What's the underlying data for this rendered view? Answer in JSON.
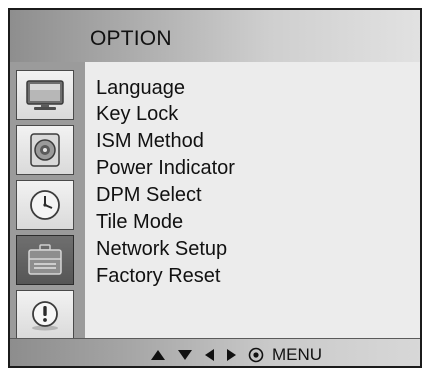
{
  "title": "OPTION",
  "sidebar": {
    "icons": [
      {
        "name": "monitor-icon"
      },
      {
        "name": "audio-icon"
      },
      {
        "name": "clock-icon"
      },
      {
        "name": "option-icon",
        "selected": true
      },
      {
        "name": "warning-icon"
      }
    ]
  },
  "menu": {
    "items": [
      {
        "label": "Language"
      },
      {
        "label": "Key Lock"
      },
      {
        "label": "ISM Method"
      },
      {
        "label": "Power Indicator"
      },
      {
        "label": "DPM Select"
      },
      {
        "label": "Tile Mode"
      },
      {
        "label": "Network Setup"
      },
      {
        "label": "Factory Reset"
      }
    ]
  },
  "footer": {
    "nav_icons": [
      "up-arrow-icon",
      "down-arrow-icon",
      "left-arrow-icon",
      "right-arrow-icon",
      "select-circle-icon"
    ],
    "menu_label": "MENU"
  },
  "colors": {
    "title_bar": "#a9a9a9",
    "sidebar": "#9b9b9b",
    "selected_tab": "#5f5f5f",
    "panel": "#ececec",
    "text": "#111111"
  }
}
